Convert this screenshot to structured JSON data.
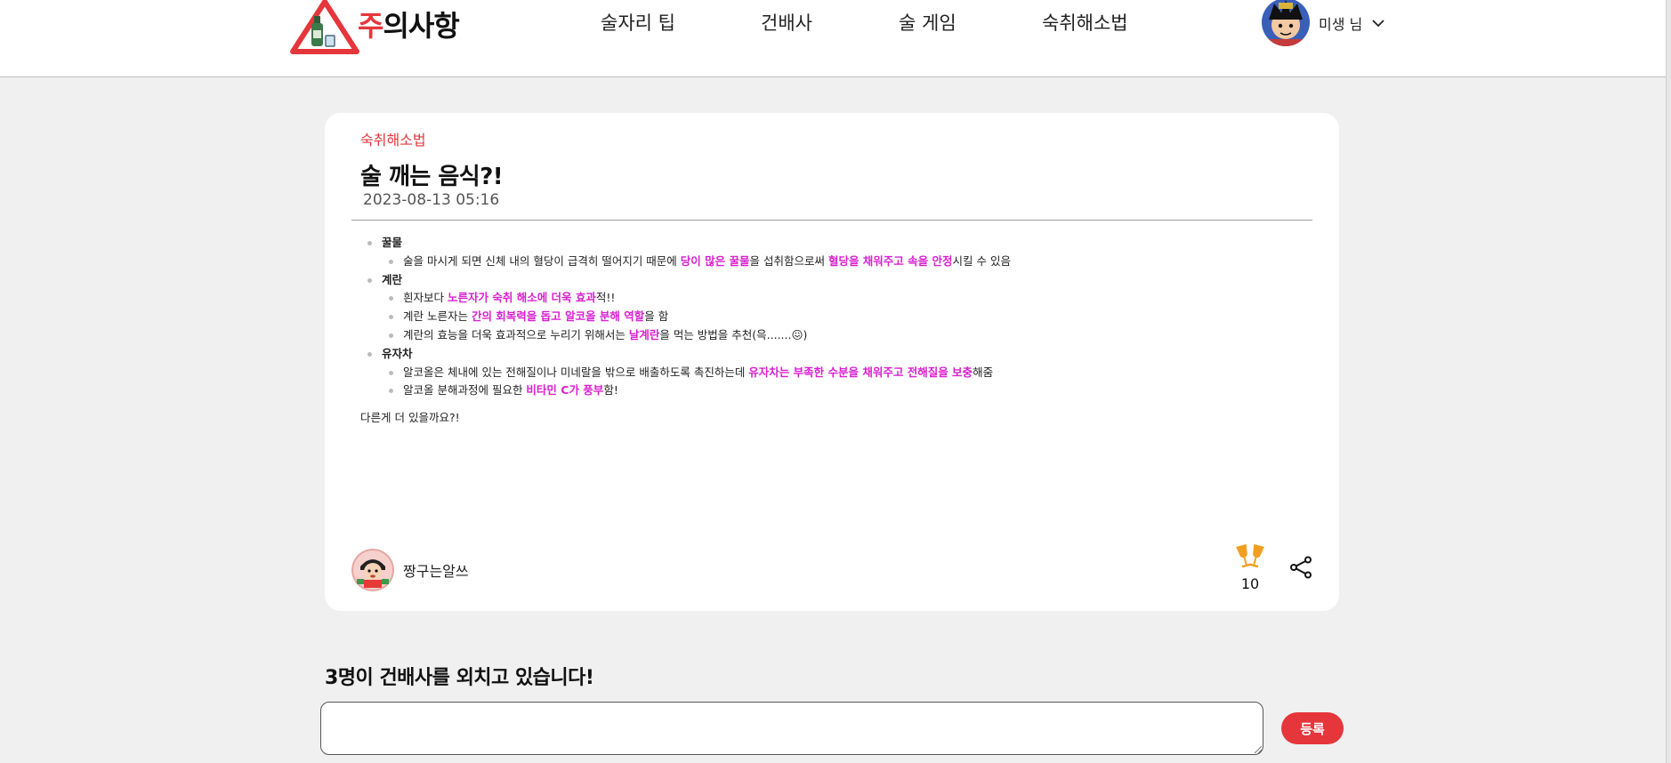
{
  "header": {
    "logo": {
      "accent_text": "주",
      "rest_text": "의사항"
    },
    "nav": [
      "술자리 팁",
      "건배사",
      "술 게임",
      "숙취해소법"
    ],
    "profile": {
      "name": "미생 님"
    }
  },
  "post": {
    "category": "숙취해소법",
    "title": "술 깨는 음식?!",
    "date": "2023-08-13 05:16",
    "sections": [
      {
        "title": "꿀물",
        "lines": [
          [
            {
              "t": "술을 마시게 되면 신체 내의 혈당이 급격히 떨어지기 때문에 "
            },
            {
              "t": "당이 많은 꿀물",
              "hl": true
            },
            {
              "t": "을 섭취함으로써 "
            },
            {
              "t": "혈당을 채워주고 속을 안정",
              "hl": true
            },
            {
              "t": "시킬 수 있음"
            }
          ]
        ]
      },
      {
        "title": "계란",
        "lines": [
          [
            {
              "t": "흰자보다 "
            },
            {
              "t": "노른자가 숙취 해소에 더욱 효과",
              "hl": true
            },
            {
              "t": "적!!"
            }
          ],
          [
            {
              "t": "계란 노른자는 "
            },
            {
              "t": "간의 회복력을 돕고 알코올 분해 역할",
              "hl": true
            },
            {
              "t": "을 함"
            }
          ],
          [
            {
              "t": "계란의 효능을 더욱 효과적으로 누리기 위해서는 "
            },
            {
              "t": "날계란",
              "hl": true
            },
            {
              "t": "을 먹는 방법을 추천(윽.......😖)"
            }
          ]
        ]
      },
      {
        "title": "유자차",
        "lines": [
          [
            {
              "t": "알코올은 체내에 있는 전해질이나 미네랄을 밖으로 배출하도록 촉진하는데 "
            },
            {
              "t": "유자차는 부족한 수분을 채워주고 전해질을 보충",
              "hl": true
            },
            {
              "t": "해줌"
            }
          ],
          [
            {
              "t": "알코올 분해과정에 필요한 "
            },
            {
              "t": "비타민 C가 풍부",
              "hl": true
            },
            {
              "t": "함!"
            }
          ]
        ]
      }
    ],
    "closing": "다른게 더 있을까요?!",
    "author": "짱구는알쓰",
    "cheers_count": "10"
  },
  "comments": {
    "title": "3명이 건배사를 외치고 있습니다!",
    "input_value": "",
    "submit_label": "등록"
  },
  "colors": {
    "accent": "#e5363c",
    "highlight": "#d81fcf",
    "cheers_icon": "#f0a020"
  },
  "icons": [
    "warning-bottle-logo-icon",
    "chevron-down-icon",
    "cheers-glasses-icon",
    "share-icon",
    "resize-grip-icon"
  ]
}
